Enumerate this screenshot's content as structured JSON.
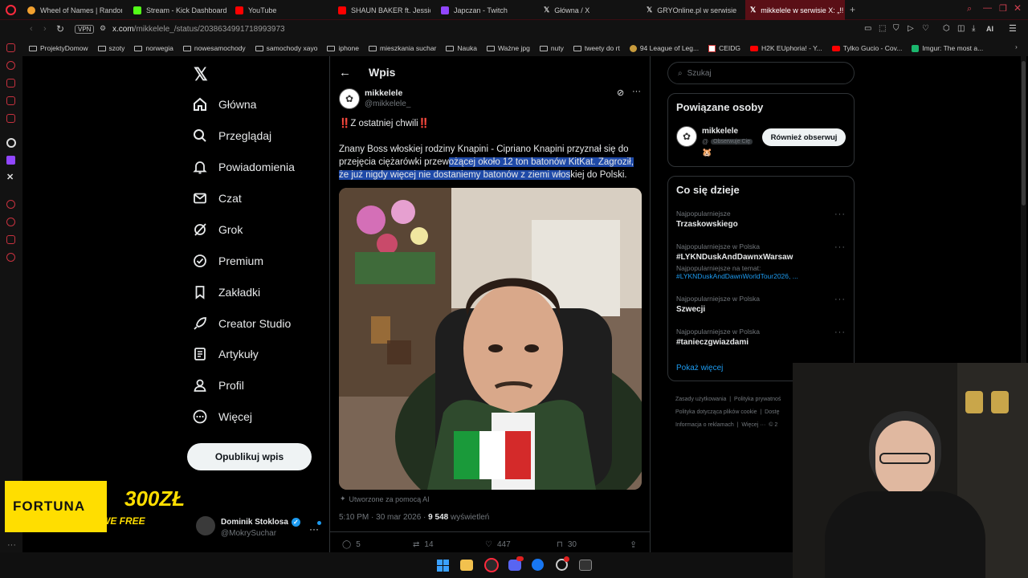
{
  "tabs": [
    {
      "label": "Wheel of Names | Random",
      "color": "#f3a12f"
    },
    {
      "label": "Stream - Kick Dashboard",
      "color": "#53fc18"
    },
    {
      "label": "YouTube",
      "color": "#ff0000"
    },
    {
      "label": "SHAUN BAKER ft. Jessica",
      "color": "#ff0000"
    },
    {
      "label": "Japczan - Twitch",
      "color": "#9146ff"
    },
    {
      "label": "Główna / X",
      "color": "#ffffff"
    },
    {
      "label": "GRYOnline.pl w serwisie X",
      "color": "#ffffff"
    },
    {
      "label": "mikkelele w serwisie X: „!!",
      "color": "#ffffff"
    }
  ],
  "browser": {
    "vpn_label": "VPN",
    "url_host": "x.com",
    "url_path": "/mikkelele_/status/2038634991718993973",
    "ai_label": "AI"
  },
  "bookmarks": [
    {
      "label": "ProjektyDomow",
      "icon": "folder-icon"
    },
    {
      "label": "szoty",
      "icon": "folder-icon"
    },
    {
      "label": "norwegia",
      "icon": "folder-icon"
    },
    {
      "label": "nowesamochody",
      "icon": "folder-icon"
    },
    {
      "label": "samochody xayo",
      "icon": "folder-icon"
    },
    {
      "label": "iphone",
      "icon": "folder-icon"
    },
    {
      "label": "mieszkania suchar",
      "icon": "folder-icon"
    },
    {
      "label": "Nauka",
      "icon": "folder-icon"
    },
    {
      "label": "Ważne jpg",
      "icon": "folder-icon"
    },
    {
      "label": "nuty",
      "icon": "folder-icon"
    },
    {
      "label": "tweety do rt",
      "icon": "folder-icon"
    },
    {
      "label": "94 League of Leg...",
      "icon": "lol-icon"
    },
    {
      "label": "CEIDG",
      "icon": "ceidg-icon"
    },
    {
      "label": "H2K EUphoria! - Y...",
      "icon": "youtube-icon"
    },
    {
      "label": "Tylko Gucio - Cov...",
      "icon": "youtube-icon"
    },
    {
      "label": "Imgur: The most a...",
      "icon": "imgur-icon"
    }
  ],
  "nav": {
    "items": [
      {
        "label": "Główna",
        "icon": "home-icon"
      },
      {
        "label": "Przeglądaj",
        "icon": "search-icon"
      },
      {
        "label": "Powiadomienia",
        "icon": "bell-icon"
      },
      {
        "label": "Czat",
        "icon": "mail-icon"
      },
      {
        "label": "Grok",
        "icon": "grok-icon"
      },
      {
        "label": "Premium",
        "icon": "premium-icon"
      },
      {
        "label": "Zakładki",
        "icon": "bookmark-icon"
      },
      {
        "label": "Creator Studio",
        "icon": "rocket-icon"
      },
      {
        "label": "Artykuły",
        "icon": "article-icon"
      },
      {
        "label": "Profil",
        "icon": "person-icon"
      },
      {
        "label": "Więcej",
        "icon": "more-circle-icon"
      }
    ],
    "post_button": "Opublikuj wpis",
    "account_name": "Dominik Stoklosa",
    "account_handle": "@MokrySuchar"
  },
  "post": {
    "header": "Wpis",
    "author_name": "mikkelele",
    "author_handle": "@mikkelele_",
    "line1": "‼️Z ostatniej chwili‼️",
    "text_before": "Znany Boss włoskiej rodziny Knapini - Cipriano Knapini przyznał się do przejęcia ciężarówki przew",
    "text_highlight": "ożącej około 12 ton batonów KitKat. Zagroził, że już nigdy więcej nie dostaniemy batonów z ziemi włos",
    "text_after": "kiej do Polski.",
    "ai_note": "Utworzone za pomocą AI",
    "time": "5:10 PM · 30 mar 2026 · ",
    "views_count": "9 548",
    "views_label": " wyświetleń",
    "replies": "5",
    "reposts": "14",
    "likes": "447",
    "bookmarks": "30"
  },
  "sidebar": {
    "search_placeholder": "Szukaj",
    "related_title": "Powiązane osoby",
    "related_name": "mikkelele",
    "related_handle": "@",
    "follows_you": "Obserwuje Cię",
    "related_emoji": "🐹",
    "follow_back_button": "Również obserwuj",
    "trending_title": "Co się dzieje",
    "trends": [
      {
        "sub": "Najpopularniejsze",
        "name": "Trzaskowskiego",
        "extra": ""
      },
      {
        "sub": "Najpopularniejsze w Polska",
        "name": "#LYKNDuskAndDawnxWarsaw",
        "extra_label": "Najpopularniejsze na temat:",
        "extra": "#LYKNDuskAndDawnWorldTour2026, ..."
      },
      {
        "sub": "Najpopularniejsze w Polska",
        "name": "Szwecji",
        "extra": ""
      },
      {
        "sub": "Najpopularniejsze w Polska",
        "name": "#tanieczgwiazdami",
        "extra": ""
      }
    ],
    "show_more": "Pokaż więcej",
    "footer": [
      "Zasady użytkowania",
      "Polityka prywatnoś",
      "Polityka dotycząca plików cookie",
      "Dostę",
      "Informacja o reklamach",
      "Więcej ···",
      "© 2"
    ]
  },
  "overlay": {
    "brand": "FORTUNA",
    "amount": "300ZŁ",
    "slogan": "WE FREE"
  },
  "colors": {
    "accent_blue": "#1d9bf0",
    "opera_red": "#ff2a3d",
    "fortuna_yellow": "#ffde00"
  }
}
